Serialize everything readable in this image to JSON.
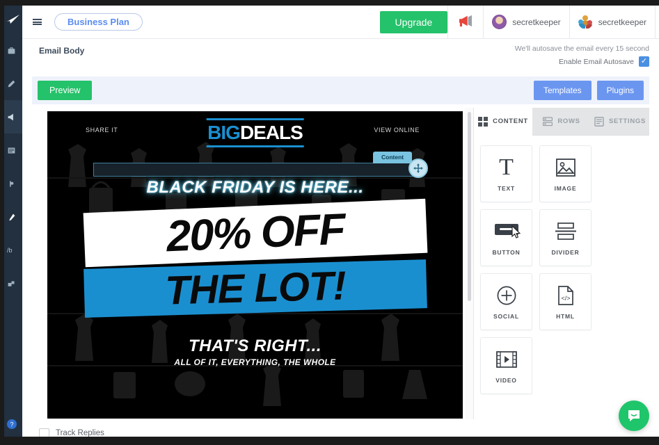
{
  "rail": {
    "logo_icon": "paper-plane-logo",
    "items": [
      {
        "icon": "briefcase-icon",
        "active": false
      },
      {
        "icon": "pencil-edit-icon",
        "active": false
      },
      {
        "icon": "megaphone-icon",
        "active": true
      },
      {
        "icon": "list-icon",
        "active": false
      },
      {
        "icon": "contact-icon",
        "active": false
      },
      {
        "icon": "wrench-icon",
        "active": false
      },
      {
        "icon": "ab-test-icon",
        "label": "/b",
        "active": false
      },
      {
        "icon": "integrations-icon",
        "active": false
      }
    ],
    "bottom_icon": "help-icon"
  },
  "topbar": {
    "menu_icon": "hamburger-icon",
    "plan_label": "Business Plan",
    "upgrade_label": "Upgrade",
    "megaphone_icon": "megaphone-icon",
    "accounts": [
      {
        "name": "secretkeeper",
        "avatar": "user-avatar"
      },
      {
        "name": "secretkeeper",
        "avatar": "team-avatar"
      }
    ]
  },
  "autosave": {
    "section_label": "Email Body",
    "note": "We'll autosave the email every 15 second",
    "checkbox_label": "Enable Email Autosave",
    "checkbox_checked": true,
    "check_glyph": "✓",
    "accent_color": "#4a90e2"
  },
  "toolbar": {
    "preview_label": "Preview",
    "templates_label": "Templates",
    "plugins_label": "Plugins",
    "preview_color": "#24c26a",
    "button_color": "#6b96f0"
  },
  "email": {
    "share_it": "SHARE IT",
    "view_online": "VIEW ONLINE",
    "logo_part1": "BIG",
    "logo_part2": "DEALS",
    "logo_accent": "#1a8fd0",
    "drop_badge": "Content",
    "drop_handle_icon": "move-plus-icon",
    "kicker": "BLACK FRIDAY IS HERE...",
    "headline": "20% OFF",
    "subheadline": "THE LOT!",
    "foot_line1": "THAT'S RIGHT...",
    "foot_line2": "ALL OF IT, EVERYTHING, THE WHOLE"
  },
  "panel": {
    "tabs": [
      {
        "label": "CONTENT",
        "icon": "grid-icon",
        "active": true
      },
      {
        "label": "ROWS",
        "icon": "rows-icon",
        "active": false
      },
      {
        "label": "SETTINGS",
        "icon": "settings-list-icon",
        "active": false
      }
    ],
    "blocks": [
      {
        "label": "TEXT",
        "icon": "text-t-icon"
      },
      {
        "label": "IMAGE",
        "icon": "image-icon"
      },
      {
        "label": "BUTTON",
        "icon": "button-icon"
      },
      {
        "label": "DIVIDER",
        "icon": "divider-icon"
      },
      {
        "label": "SOCIAL",
        "icon": "social-plus-icon"
      },
      {
        "label": "HTML",
        "icon": "html-code-icon"
      },
      {
        "label": "VIDEO",
        "icon": "video-film-icon"
      }
    ]
  },
  "footer": {
    "track_replies_label": "Track Replies",
    "track_replies_checked": false
  },
  "chat": {
    "icon": "chat-bubble-icon",
    "color": "#1fc56b"
  }
}
